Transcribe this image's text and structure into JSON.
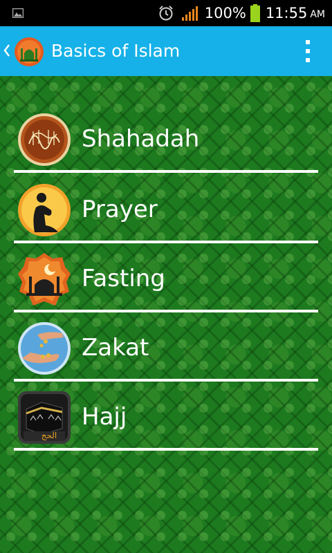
{
  "status_bar": {
    "battery": "100%",
    "time": "11:55",
    "ampm": "AM",
    "icons": [
      "image-icon",
      "alarm-icon",
      "signal-icon",
      "battery-icon"
    ]
  },
  "action_bar": {
    "title": "Basics of Islam",
    "background": "#16b1e8",
    "icons": [
      "back-chevron-icon",
      "mosque-logo-icon",
      "overflow-menu-icon"
    ]
  },
  "menu": [
    {
      "label": "Shahadah",
      "icon": "shahadah-calligraphy-icon"
    },
    {
      "label": "Prayer",
      "icon": "praying-person-icon"
    },
    {
      "label": "Fasting",
      "icon": "mosque-crescent-icon"
    },
    {
      "label": "Zakat",
      "icon": "giving-hands-coins-icon"
    },
    {
      "label": "Hajj",
      "icon": "kaaba-icon",
      "icon_caption": "الحج"
    }
  ],
  "colors": {
    "background_green": "#1d7a1f",
    "divider": "#ffffff",
    "text": "#ffffff"
  }
}
